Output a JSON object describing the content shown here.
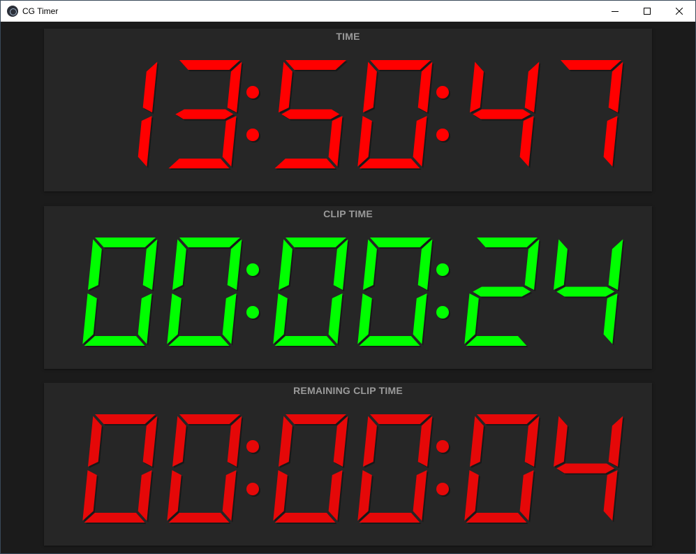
{
  "window": {
    "title": "CG Timer",
    "icon": "cg-timer-app-icon",
    "controls": [
      "minimize-icon",
      "maximize-icon",
      "close-icon"
    ]
  },
  "timers": [
    {
      "label": "TIME",
      "value": "13:50:47",
      "color": "#ff0000"
    },
    {
      "label": "CLIP TIME",
      "value": "00:00:24",
      "color": "#00ff00"
    },
    {
      "label": "REMAINING CLIP TIME",
      "value": "00:00:04",
      "color": "#e50808"
    }
  ],
  "colors": {
    "background": "#1b1b1b",
    "panel": "#262626",
    "label": "#9a9a9a"
  }
}
